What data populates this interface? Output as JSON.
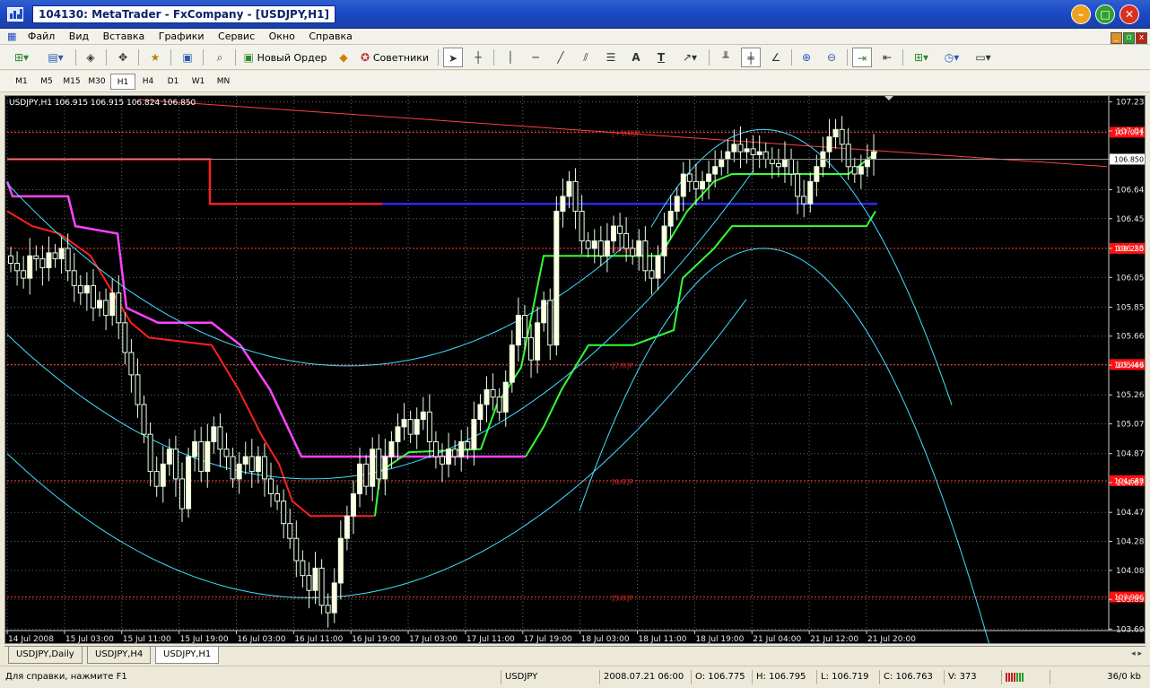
{
  "window": {
    "title": "104130: MetaTrader - FxCompany - [USDJPY,H1]"
  },
  "menu": [
    "Файл",
    "Вид",
    "Вставка",
    "Графики",
    "Сервис",
    "Окно",
    "Справка"
  ],
  "toolbar": {
    "new_order": "Новый Ордер",
    "experts": "Советники",
    "text_tool": "A",
    "text_label_tool": "T"
  },
  "timeframes": [
    "M1",
    "M5",
    "M15",
    "M30",
    "H1",
    "H4",
    "D1",
    "W1",
    "MN"
  ],
  "active_timeframe": "H1",
  "chart_header": "USDJPY,H1  106.915 106.915 106.824 106.850",
  "chart_data": {
    "type": "candlestick",
    "symbol": "USDJPY",
    "timeframe": "H1",
    "y_ticks": [
      "107.235",
      "107.040",
      "106.850",
      "106.645",
      "106.450",
      "106.250",
      "106.055",
      "105.855",
      "105.660",
      "105.465",
      "105.265",
      "105.070",
      "104.870",
      "104.675",
      "104.475",
      "104.280",
      "104.085",
      "103.890",
      "103.690"
    ],
    "ylim": [
      103.68,
      107.275
    ],
    "x_ticks": [
      "14 Jul 2008",
      "15 Jul 03:00",
      "15 Jul 11:00",
      "15 Jul 19:00",
      "16 Jul 03:00",
      "16 Jul 11:00",
      "16 Jul 19:00",
      "17 Jul 03:00",
      "17 Jul 11:00",
      "17 Jul 19:00",
      "18 Jul 03:00",
      "18 Jul 11:00",
      "18 Jul 19:00",
      "21 Jul 04:00",
      "21 Jul 12:00",
      "21 Jul 20:00"
    ],
    "levels": [
      {
        "value": 107.031,
        "tag": "107.031",
        "label": "[+1/8]P"
      },
      {
        "value": 106.25,
        "tag": "106.250",
        "label": "[8/8]P"
      },
      {
        "value": 105.469,
        "tag": "105.469",
        "label": "[7/8]P"
      },
      {
        "value": 104.688,
        "tag": "104.688",
        "label": "[6/8]P"
      },
      {
        "value": 103.906,
        "tag": "103.906",
        "label": "[5/8]P"
      }
    ],
    "current_price": 106.85,
    "current_price_label": "106.850",
    "closes": [
      106.15,
      106.1,
      106.05,
      106.2,
      106.18,
      106.12,
      106.22,
      106.18,
      106.25,
      106.1,
      106.0,
      105.95,
      106.0,
      105.85,
      105.9,
      105.8,
      105.95,
      105.75,
      105.55,
      105.4,
      105.2,
      105.0,
      104.75,
      104.65,
      104.8,
      104.9,
      104.7,
      104.5,
      104.85,
      104.95,
      104.75,
      104.95,
      105.05,
      104.9,
      104.85,
      104.7,
      104.8,
      104.85,
      104.75,
      104.85,
      104.7,
      104.6,
      104.55,
      104.4,
      104.3,
      104.15,
      104.05,
      103.95,
      104.1,
      103.85,
      103.8,
      104.0,
      104.3,
      104.45,
      104.6,
      104.8,
      104.65,
      104.9,
      104.7,
      104.85,
      104.95,
      105.05,
      105.1,
      105.0,
      105.1,
      105.15,
      104.95,
      104.85,
      104.8,
      104.9,
      104.85,
      104.95,
      104.9,
      105.1,
      105.2,
      105.3,
      105.25,
      105.15,
      105.35,
      105.6,
      105.8,
      105.65,
      105.5,
      105.75,
      105.9,
      105.6,
      106.5,
      106.6,
      106.7,
      106.5,
      106.3,
      106.25,
      106.3,
      106.2,
      106.3,
      106.4,
      106.35,
      106.25,
      106.2,
      106.3,
      106.1,
      106.05,
      106.2,
      106.4,
      106.5,
      106.6,
      106.75,
      106.7,
      106.65,
      106.7,
      106.75,
      106.8,
      106.85,
      106.9,
      106.95,
      106.9,
      106.92,
      106.88,
      106.9,
      106.85,
      106.82,
      106.8,
      106.85,
      106.75,
      106.6,
      106.55,
      106.7,
      106.8,
      106.9,
      107.0,
      107.05,
      106.95,
      106.8,
      106.75,
      106.8,
      106.85,
      106.9
    ],
    "series": [
      {
        "color": "#ff2020"
      },
      {
        "color": "#ff44ff"
      },
      {
        "color": "#2a2aff"
      },
      {
        "color": "#33ff33"
      },
      {
        "color": "#33ff33"
      },
      {
        "color": "#40e0ff"
      },
      {
        "color": "#ff4040"
      }
    ]
  },
  "chart_tabs": [
    "USDJPY,Daily",
    "USDJPY,H4",
    "USDJPY,H1"
  ],
  "active_chart_tab": "USDJPY,H1",
  "status": {
    "help": "Для справки, нажмите F1",
    "symbol": "USDJPY",
    "time": "2008.07.21 06:00",
    "open": "O: 106.775",
    "high": "H: 106.795",
    "low": "L: 106.719",
    "close": "C: 106.763",
    "volume": "V: 373",
    "traffic": "36/0 kb"
  }
}
